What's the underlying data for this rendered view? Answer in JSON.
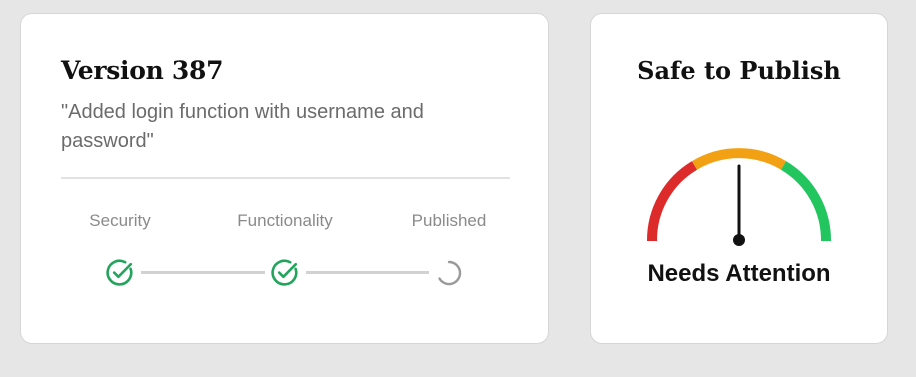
{
  "version_card": {
    "title": "Version 387",
    "description": "\"Added login function with username and password\"",
    "steps": [
      {
        "label": "Security",
        "status": "complete",
        "icon": "check-circle-icon"
      },
      {
        "label": "Functionality",
        "status": "complete",
        "icon": "check-circle-icon"
      },
      {
        "label": "Published",
        "status": "pending",
        "icon": "loading-spinner-icon"
      }
    ]
  },
  "safety_card": {
    "title": "Safe to Publish",
    "status_text": "Needs Attention",
    "gauge": {
      "segments": [
        "red",
        "orange",
        "green"
      ],
      "needle_position": "middle"
    }
  },
  "colors": {
    "complete": "#22a45d",
    "pending": "#9a9a9a",
    "gauge_red": "#dd2a2a",
    "gauge_orange": "#f2a114",
    "gauge_green": "#22c55e",
    "needle": "#111111"
  }
}
